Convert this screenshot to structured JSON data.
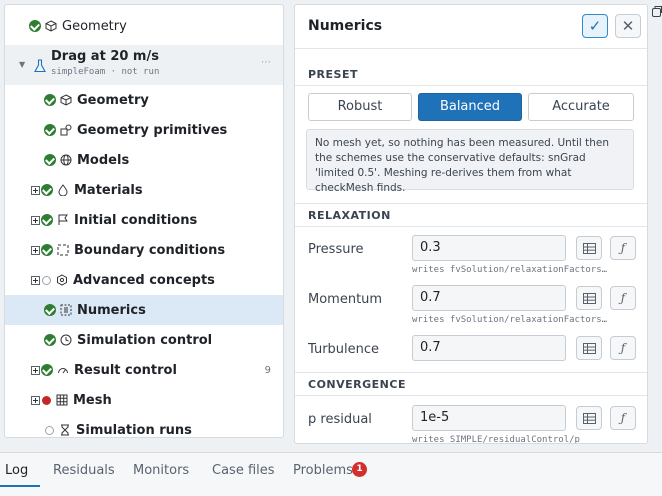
{
  "tree": {
    "top_item": "Geometry",
    "case": {
      "title": "Drag at 20 m/s",
      "subtitle": "simpleFoam · not run",
      "more": "⋯"
    },
    "items": [
      {
        "label": "Geometry"
      },
      {
        "label": "Geometry primitives"
      },
      {
        "label": "Models"
      },
      {
        "label": "Materials"
      },
      {
        "label": "Initial conditions"
      },
      {
        "label": "Boundary conditions"
      },
      {
        "label": "Advanced concepts"
      },
      {
        "label": "Numerics"
      },
      {
        "label": "Simulation control"
      },
      {
        "label": "Result control",
        "count": "9"
      },
      {
        "label": "Mesh"
      },
      {
        "label": "Simulation runs"
      }
    ]
  },
  "panel": {
    "title": "Numerics",
    "confirm_icon": "✓",
    "close_icon": "✕",
    "preset_heading": "PRESET",
    "presets": [
      "Robust",
      "Balanced",
      "Accurate"
    ],
    "selected_preset": "Balanced",
    "note": "No mesh yet, so nothing has been measured. Until then the schemes use the conservative defaults: snGrad 'limited 0.5'. Meshing re-derives them from what checkMesh finds.",
    "relaxation_heading": "RELAXATION",
    "relaxation": [
      {
        "label": "Pressure",
        "value": "0.3",
        "writes": "writes  fvSolution/relaxationFactors…"
      },
      {
        "label": "Momentum",
        "value": "0.7",
        "writes": "writes  fvSolution/relaxationFactors…"
      },
      {
        "label": "Turbulence",
        "value": "0.7"
      }
    ],
    "convergence_heading": "CONVERGENCE",
    "convergence": [
      {
        "label": "p residual",
        "value": "1e-5",
        "writes": "writes  SIMPLE/residualControl/p"
      }
    ],
    "table_icon": "table-icon",
    "function_label": "ƒ"
  },
  "tabs": [
    {
      "label": "Log"
    },
    {
      "label": "Residuals"
    },
    {
      "label": "Monitors"
    },
    {
      "label": "Case files"
    },
    {
      "label": "Problems",
      "badge": "1"
    }
  ],
  "colors": {
    "accent": "#1f72b8",
    "ok": "#2e7d32",
    "error": "#c62828",
    "selected_row": "#dbe9f6"
  }
}
